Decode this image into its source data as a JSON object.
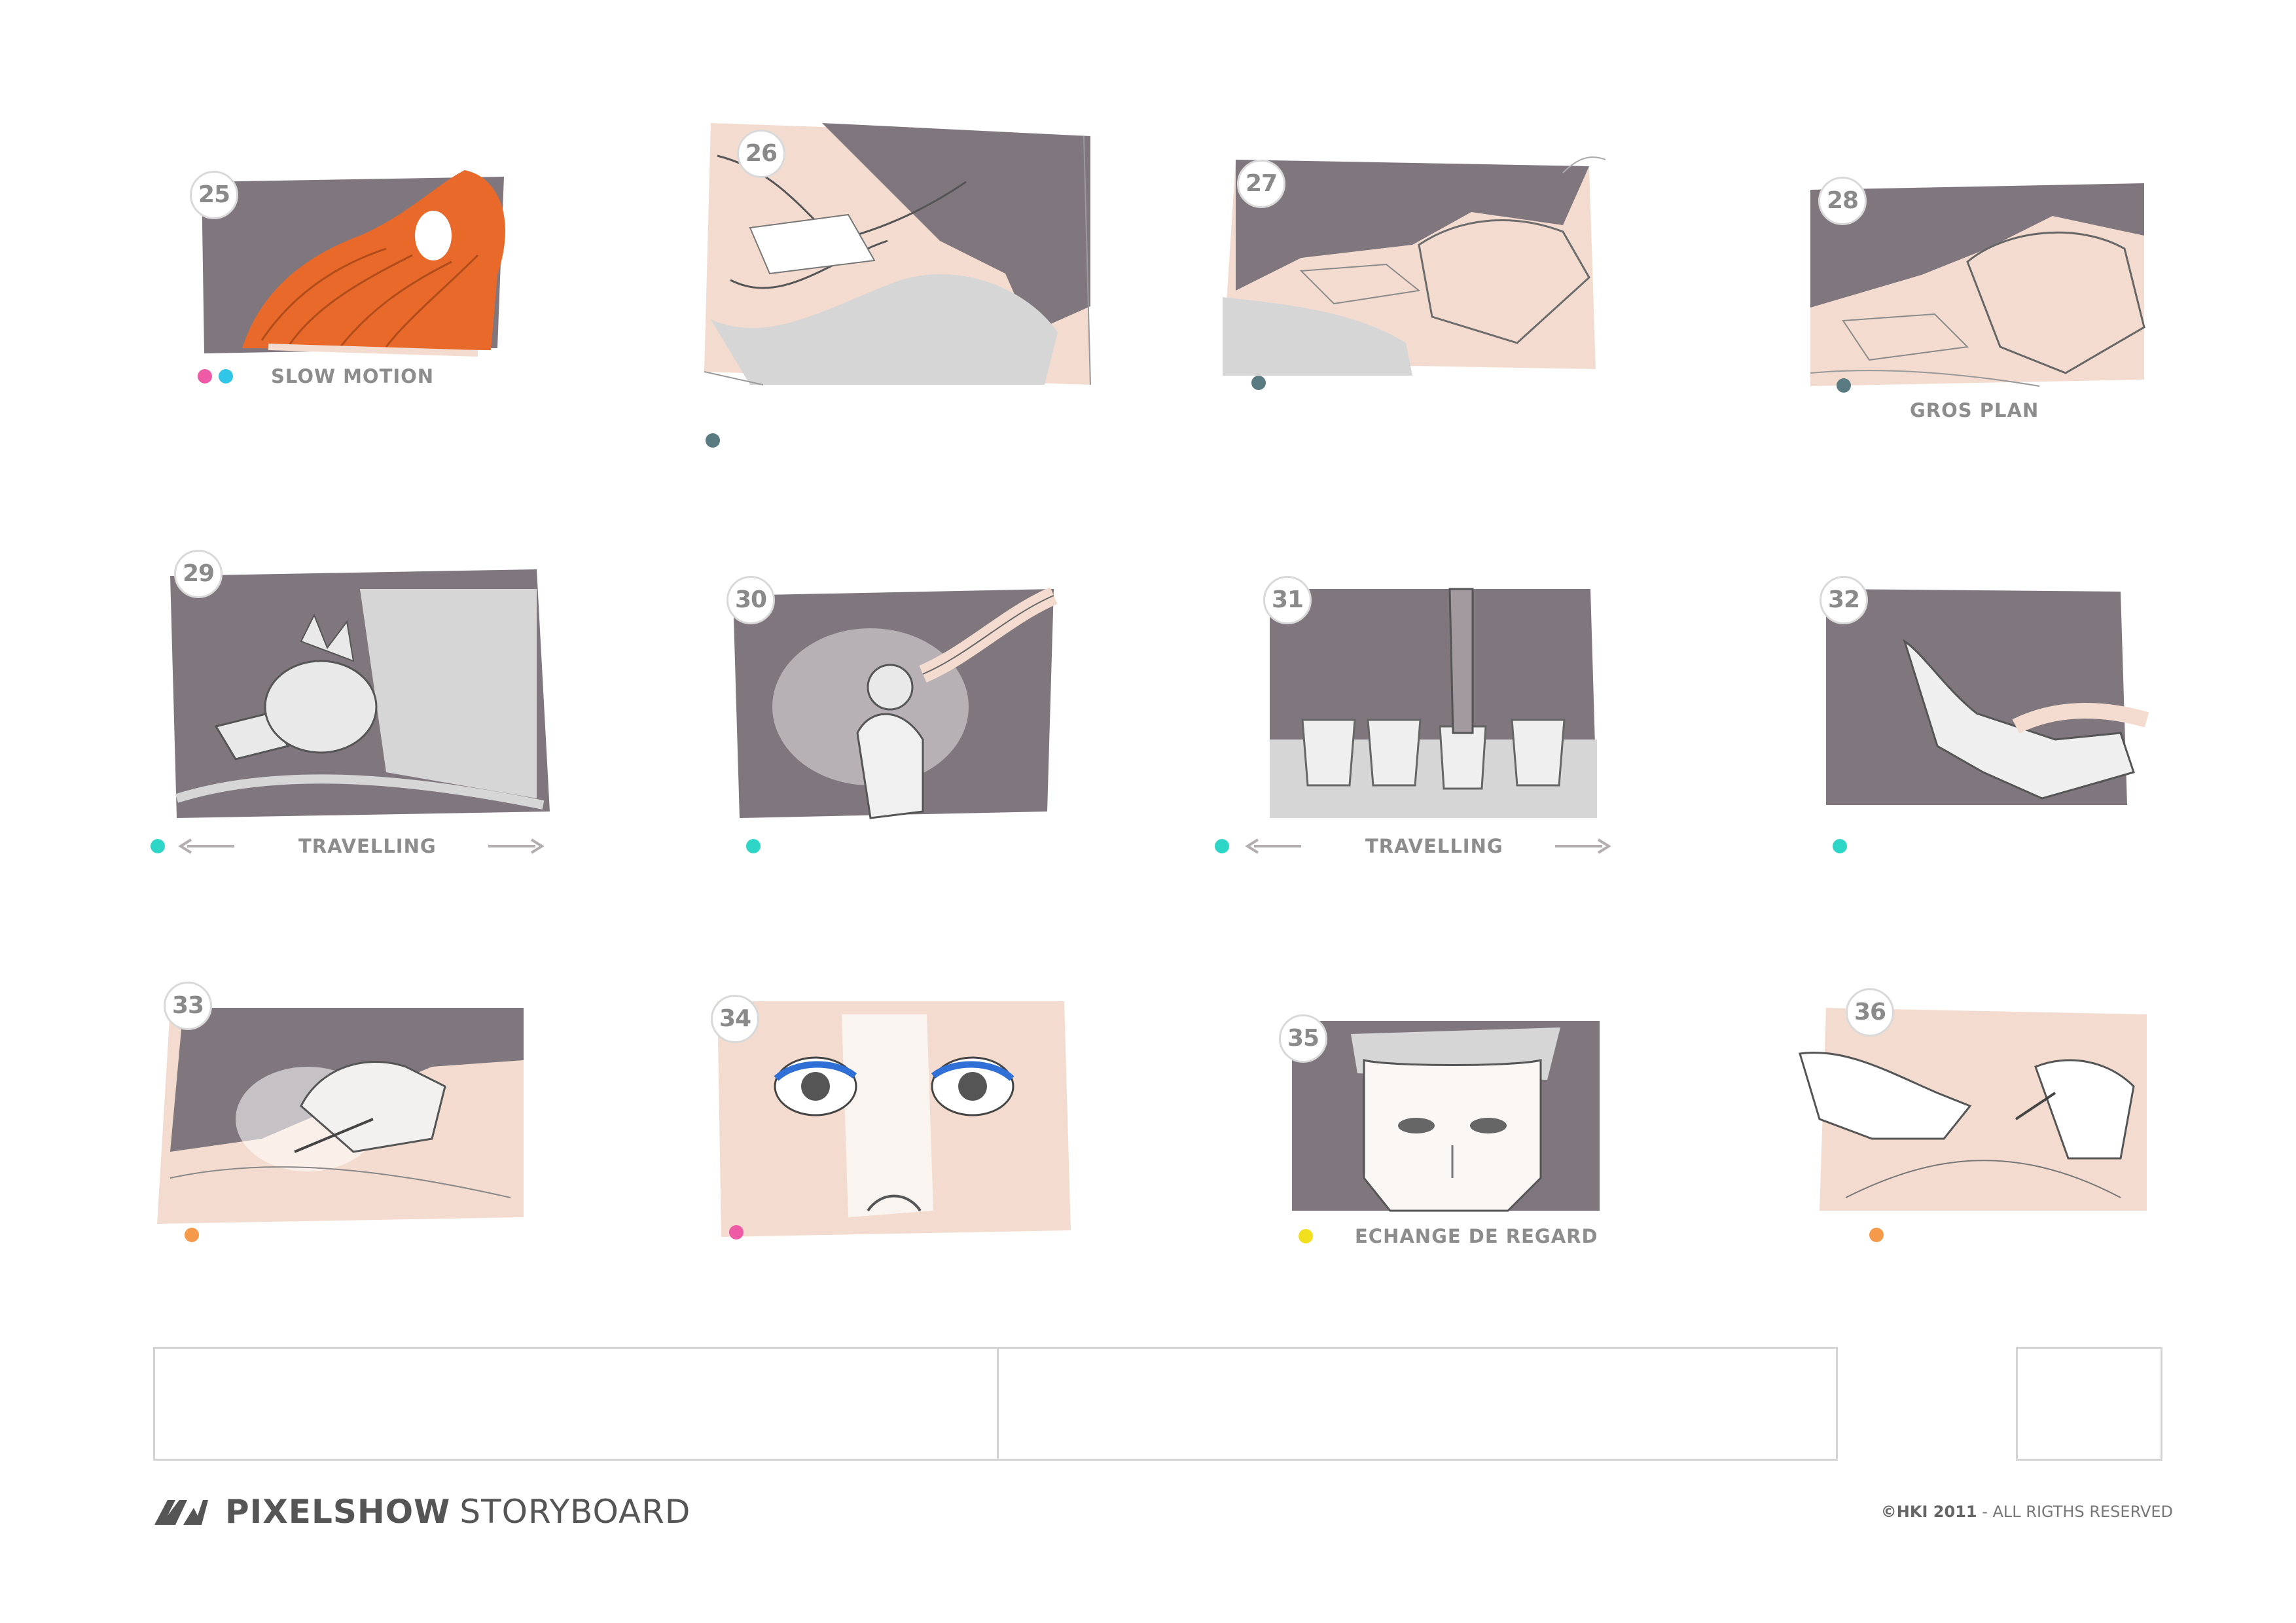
{
  "storyboard": {
    "panels": [
      {
        "number": "25",
        "caption": "SLOW MOTION",
        "dots": [
          "#ee5aa5",
          "#2fc6e8"
        ]
      },
      {
        "number": "26",
        "caption": "",
        "dots": [
          "#5a7b82"
        ]
      },
      {
        "number": "27",
        "caption": "",
        "dots": [
          "#5a7b82"
        ]
      },
      {
        "number": "28",
        "caption": "GROS PLAN",
        "dots": [
          "#5a7b82"
        ]
      },
      {
        "number": "29",
        "caption": "TRAVELLING",
        "dots": [
          "#2ed6c8"
        ]
      },
      {
        "number": "30",
        "caption": "",
        "dots": [
          "#2ed6c8"
        ]
      },
      {
        "number": "31",
        "caption": "TRAVELLING",
        "dots": [
          "#2ed6c8"
        ]
      },
      {
        "number": "32",
        "caption": "",
        "dots": [
          "#2ed6c8"
        ]
      },
      {
        "number": "33",
        "caption": "",
        "dots": [
          "#f59a4a"
        ]
      },
      {
        "number": "34",
        "caption": "",
        "dots": [
          "#ee5aa5"
        ]
      },
      {
        "number": "35",
        "caption": "ECHANGE DE REGARD",
        "dots": [
          "#f2e01e"
        ]
      },
      {
        "number": "36",
        "caption": "",
        "dots": [
          "#f59a4a"
        ]
      }
    ]
  },
  "footer": {
    "brand_bold": "PIXELSHOW",
    "brand_light": "STORYBOARD",
    "copyright_bold": "©HKI 2011",
    "copyright_rest": " - ALL RIGTHS RESERVED"
  },
  "colors": {
    "shadow_gray": "#7f777d",
    "skin_tint": "#f3dccf",
    "light_gray": "#d6d6d6",
    "hair_orange": "#e8692a",
    "eyeliner_blue": "#2f6fd6",
    "caption_gray": "#8d8d8d"
  }
}
